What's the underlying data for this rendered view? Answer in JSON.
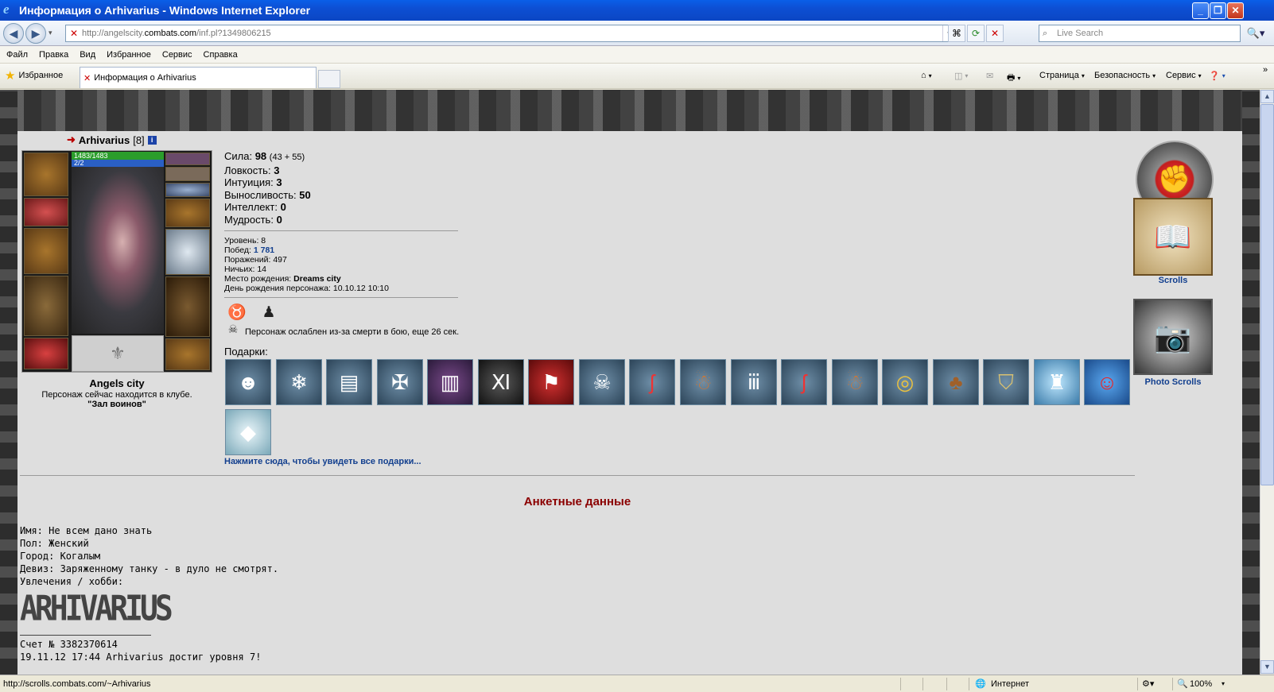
{
  "window": {
    "title": "Информация о Arhivarius - Windows Internet Explorer"
  },
  "nav": {
    "url_prefix": "http://angelscity.",
    "url_domain": "combats.com",
    "url_suffix": "/inf.pl?1349806215",
    "search_placeholder": "Live Search"
  },
  "menu": [
    "Файл",
    "Правка",
    "Вид",
    "Избранное",
    "Сервис",
    "Справка"
  ],
  "favorites": {
    "label": "Избранное",
    "tab_title": "Информация о Arhivarius"
  },
  "commands": {
    "page": "Страница",
    "security": "Безопасность",
    "tools": "Сервис"
  },
  "character": {
    "name": "Arhivarius",
    "level": "[8]",
    "hp": "1483/1483",
    "mp": "2/2",
    "city": "Angels city",
    "location_text": "Персонаж сейчас находится в клубе.",
    "location_room": "\"Зал воинов\""
  },
  "stats": [
    {
      "label": "Сила:",
      "value": "98",
      "extra": "(43 + 55)"
    },
    {
      "label": "Ловкость:",
      "value": "3",
      "extra": ""
    },
    {
      "label": "Интуиция:",
      "value": "3",
      "extra": ""
    },
    {
      "label": "Выносливость:",
      "value": "50",
      "extra": ""
    },
    {
      "label": "Интеллект:",
      "value": "0",
      "extra": ""
    },
    {
      "label": "Мудрость:",
      "value": "0",
      "extra": ""
    }
  ],
  "info": {
    "level_label": "Уровень:",
    "level": "8",
    "wins_label": "Побед:",
    "wins": "1 781",
    "losses_label": "Поражений:",
    "losses": "497",
    "draws_label": "Ничьих:",
    "draws": "14",
    "birthplace_label": "Место рождения:",
    "birthplace": "Dreams city",
    "birthday_label": "День рождения персонажа:",
    "birthday": "10.10.12 10:10"
  },
  "effects": {
    "weakened": "Персонаж ослаблен из-за смерти в бою, еще 26 сек."
  },
  "gifts": {
    "label": "Подарки:",
    "link": "Нажмите сюда, чтобы увидеть все подарки...",
    "items": [
      "bust",
      "snowball",
      "book-shield",
      "book-sword",
      "book-purple",
      "card-xi",
      "banner",
      "skull-goblet",
      "candy-cane",
      "gingerbread",
      "icicles",
      "candy-cane",
      "gingerbread",
      "ring",
      "cookie-tree",
      "badge",
      "ice-castle",
      "santa-ball",
      "ice-crystal"
    ]
  },
  "anketa": {
    "title": "Анкетные данные",
    "lines": [
      "Имя: Не всем дано знать",
      "Пол: Женский",
      "Город: Когалым",
      "Девиз: Заряженному танку - в дуло не смотрят.",
      "Увлечения / хобби:"
    ],
    "signature": "ARHIVARIUS",
    "account": "Счет № 3382370614",
    "log": "19.11.12 17:44 Arhivarius достиг уровня 7!"
  },
  "side": {
    "scrolls": "Scrolls",
    "photo_scrolls": "Photo Scrolls"
  },
  "status": {
    "url": "http://scrolls.combats.com/~Arhivarius",
    "zone": "Интернет",
    "zoom": "100%"
  }
}
